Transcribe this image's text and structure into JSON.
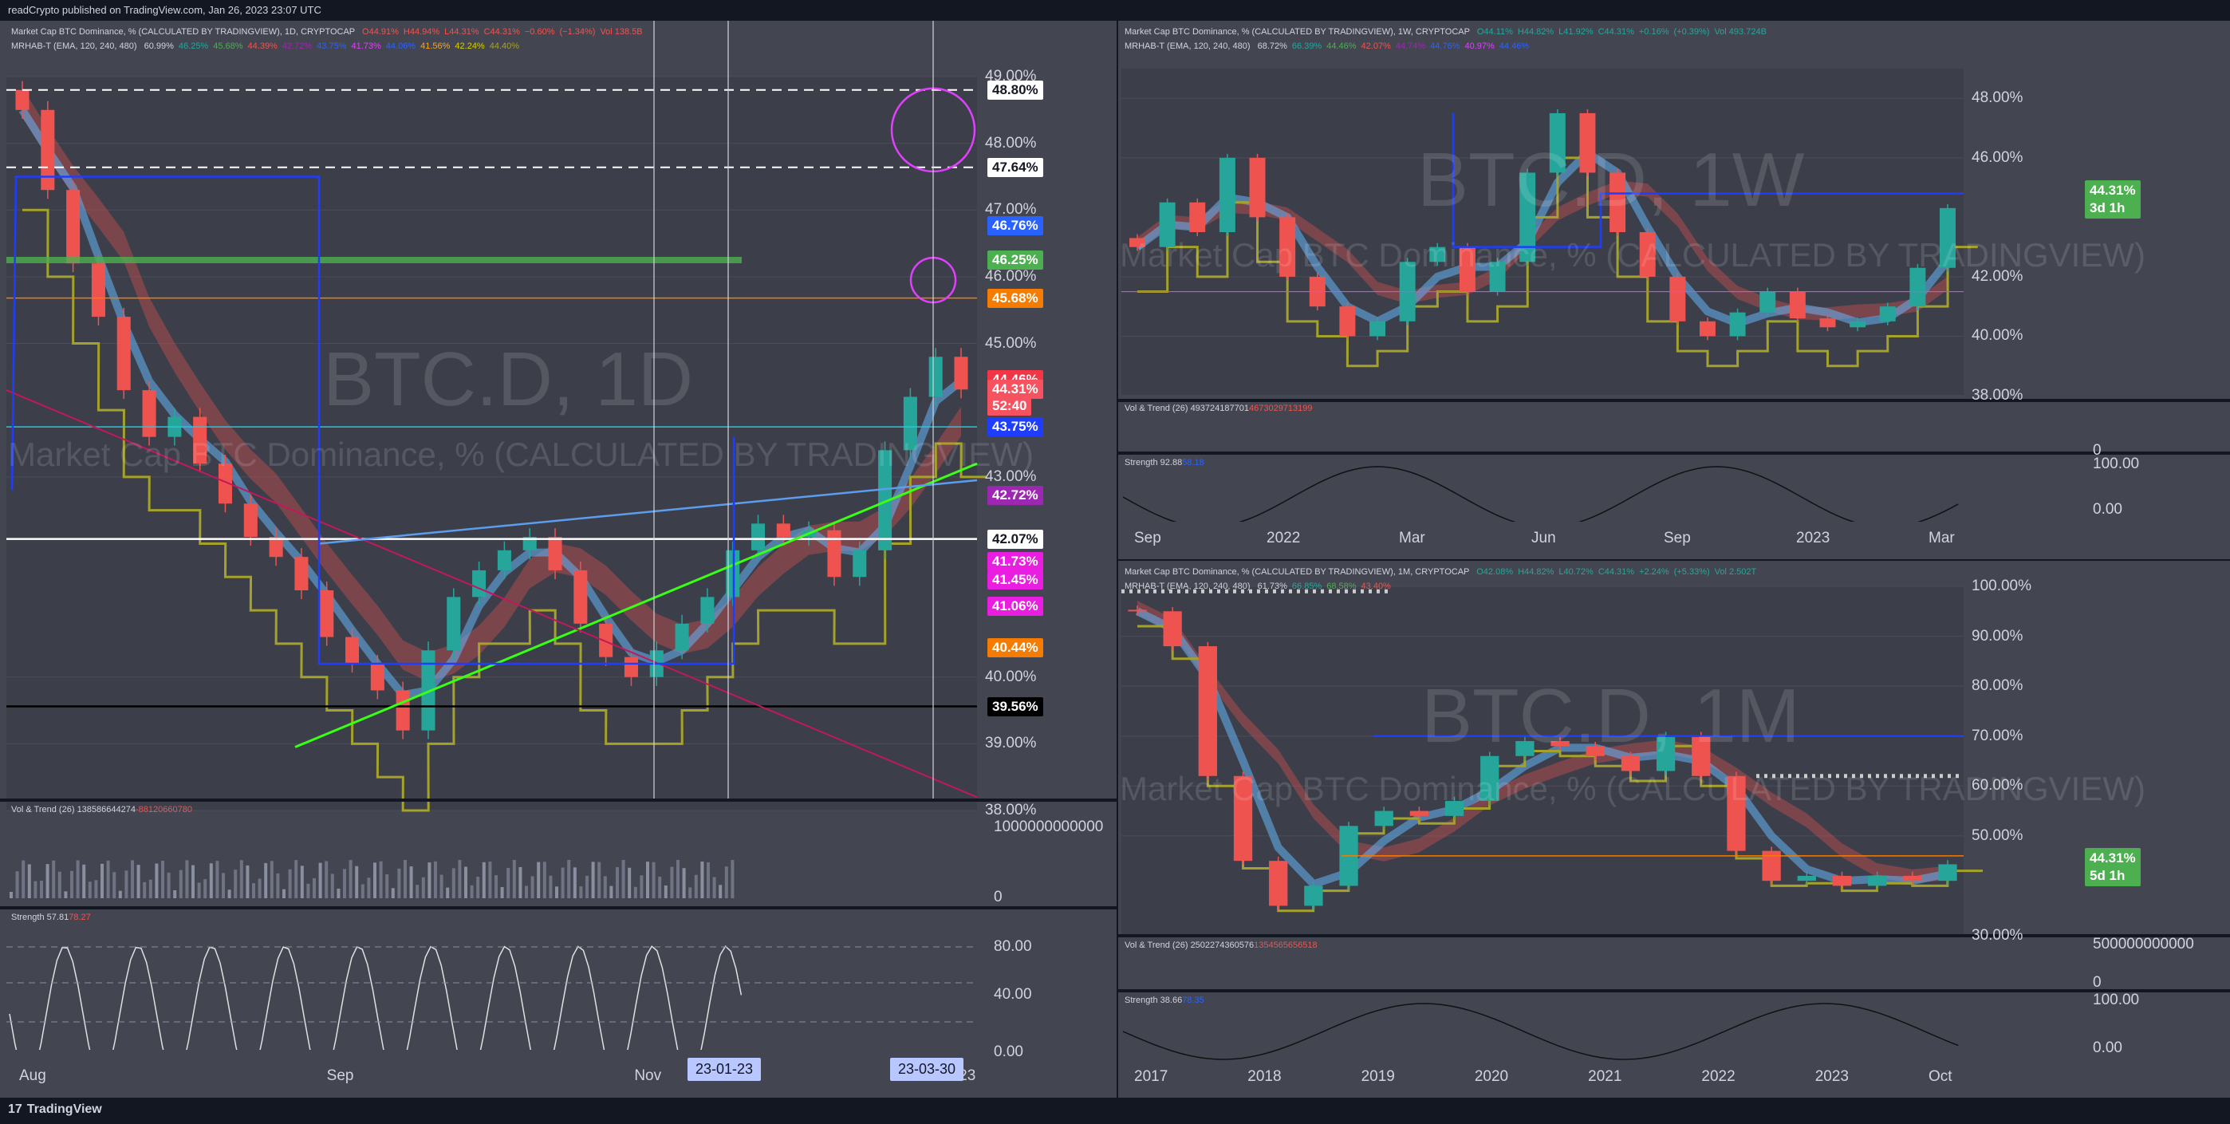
{
  "header": {
    "text": "readCrypto published on TradingView.com, Jan 26, 2023 23:07 UTC"
  },
  "footer": {
    "logo": "TradingView",
    "logo_mark": "17"
  },
  "colors": {
    "bg": "#131722",
    "panel": "#434651",
    "red": "#ef5350",
    "green": "#26a69a",
    "blue": "#1e3dff",
    "olive": "#a4a22a",
    "orange": "#f5a623",
    "magenta": "#e040fb",
    "lime": "#4caf50"
  },
  "panel_daily": {
    "legend_main": "Market Cap BTC Dominance, % (CALCULATED BY TRADINGVIEW), 1D, CRYPTOCAP",
    "legend_main_values": [
      "O44.91%",
      "H44.94%",
      "L44.31%",
      "C44.31%",
      "−0.60%",
      "(−1.34%)",
      "Vol 138.5B"
    ],
    "legend_mrhab": "MRHAB-T (EMA, 120, 240, 480)",
    "legend_mrhab_values": [
      "60.99%",
      "46.25%",
      "45.68%",
      "44.39%",
      "42.72%",
      "43.75%",
      "41.73%",
      "44.06%",
      "41.56%",
      "42.24%",
      "44.40%"
    ],
    "watermark_big": "BTC.D, 1D",
    "watermark_small": "Market Cap BTC Dominance, % (CALCULATED BY TRADINGVIEW)",
    "sub1_legend": "Vol & Trend (26)",
    "sub1_values": [
      "138586644274",
      "-88120660780"
    ],
    "sub2_legend": "Strength",
    "sub2_values": [
      "57.81",
      "78.27"
    ],
    "date_tags": [
      "23-01-23",
      "23-03-30"
    ]
  },
  "panel_weekly": {
    "legend_main": "Market Cap BTC Dominance, % (CALCULATED BY TRADINGVIEW), 1W, CRYPTOCAP",
    "legend_main_values": [
      "O44.11%",
      "H44.82%",
      "L41.92%",
      "C44.31%",
      "+0.16%",
      "(+0.39%)",
      "Vol 493.724B"
    ],
    "legend_mrhab": "MRHAB-T (EMA, 120, 240, 480)",
    "legend_mrhab_values": [
      "68.72%",
      "66.39%",
      "44.46%",
      "42.07%",
      "44.74%",
      "44.76%",
      "40.97%",
      "44.46%"
    ],
    "watermark_big": "BTC.D, 1W",
    "watermark_small": "Market Cap BTC Dominance, % (CALCULATED BY TRADINGVIEW)",
    "price_tag": "44.31%",
    "price_tag_sub": "3d 1h",
    "sub1_legend": "Vol & Trend (26)",
    "sub1_values": [
      "493724187701",
      "4673029713199"
    ],
    "sub2_legend": "Strength",
    "sub2_values": [
      "92.88",
      "58.18"
    ]
  },
  "panel_monthly": {
    "legend_main": "Market Cap BTC Dominance, % (CALCULATED BY TRADINGVIEW), 1M, CRYPTOCAP",
    "legend_main_values": [
      "O42.08%",
      "H44.82%",
      "L40.72%",
      "C44.31%",
      "+2.24%",
      "(+5.33%)",
      "Vol 2.502T"
    ],
    "legend_mrhab": "MRHAB-T (EMA, 120, 240, 480)",
    "legend_mrhab_values": [
      "61.73%",
      "66.85%",
      "68.58%",
      "43.40%"
    ],
    "watermark_big": "BTC.D, 1M",
    "watermark_small": "Market Cap BTC Dominance, % (CALCULATED BY TRADINGVIEW)",
    "price_tag": "44.31%",
    "price_tag_sub": "5d 1h",
    "sub1_legend": "Vol & Trend (26)",
    "sub1_values": [
      "2502274360576",
      "1354565656518"
    ],
    "sub2_legend": "Strength",
    "sub2_values": [
      "38.66",
      "78.35"
    ]
  },
  "chart_data": [
    {
      "type": "line",
      "title": "BTC.D, 1D",
      "x": [
        "Aug",
        "Sep",
        "Nov",
        "2023"
      ],
      "ylim": [
        38.0,
        49.0
      ],
      "y_ticks": [
        "49.00%",
        "48.00%",
        "47.00%",
        "46.00%",
        "45.00%",
        "43.00%",
        "40.00%",
        "39.00%",
        "38.00%"
      ],
      "level_tags": [
        {
          "label": "48.80%",
          "value": 48.8,
          "bg": "#ffffff",
          "fg": "#131722"
        },
        {
          "label": "47.64%",
          "value": 47.64,
          "bg": "#ffffff",
          "fg": "#131722"
        },
        {
          "label": "46.76%",
          "value": 46.76,
          "bg": "#2962ff",
          "fg": "#ffffff"
        },
        {
          "label": "46.25%",
          "value": 46.25,
          "bg": "#4caf50",
          "fg": "#ffffff"
        },
        {
          "label": "45.68%",
          "value": 45.68,
          "bg": "#f57c00",
          "fg": "#ffffff"
        },
        {
          "label": "44.46%",
          "value": 44.46,
          "bg": "#f23645",
          "fg": "#ffffff"
        },
        {
          "label": "44.31%",
          "value": 44.31,
          "bg": "#f7525f",
          "fg": "#ffffff"
        },
        {
          "label": "52:40",
          "value": 44.06,
          "bg": "#f7525f",
          "fg": "#ffffff"
        },
        {
          "label": "43.75%",
          "value": 43.75,
          "bg": "#1e3dff",
          "fg": "#ffffff"
        },
        {
          "label": "42.72%",
          "value": 42.72,
          "bg": "#9c27b0",
          "fg": "#ffffff"
        },
        {
          "label": "42.07%",
          "value": 42.07,
          "bg": "#ffffff",
          "fg": "#131722"
        },
        {
          "label": "41.73%",
          "value": 41.73,
          "bg": "#e91ee0",
          "fg": "#ffffff"
        },
        {
          "label": "41.45%",
          "value": 41.45,
          "bg": "#e91ee0",
          "fg": "#ffffff"
        },
        {
          "label": "41.06%",
          "value": 41.06,
          "bg": "#e91ee0",
          "fg": "#ffffff"
        },
        {
          "label": "40.44%",
          "value": 40.44,
          "bg": "#f57c00",
          "fg": "#ffffff"
        },
        {
          "label": "39.56%",
          "value": 39.56,
          "bg": "#000000",
          "fg": "#ffffff"
        }
      ],
      "series": [
        {
          "name": "",
          "values": [
            48.5,
            47.3,
            46.2,
            45.4,
            44.3,
            43.6,
            43.9,
            43.2,
            42.6,
            42.1,
            41.8,
            41.3,
            40.6,
            40.2,
            39.8,
            39.2,
            40.4,
            41.2,
            41.6,
            41.9,
            42.1,
            41.6,
            40.8,
            40.3,
            40.0,
            40.4,
            40.8,
            41.2,
            41.9,
            42.3,
            42.1,
            42.2,
            41.5,
            41.9,
            43.4,
            44.2,
            44.8,
            44.31
          ]
        }
      ],
      "sub_y_ticks": [
        "1000000000000",
        "0",
        "80.00",
        "40.00",
        "0.00"
      ]
    },
    {
      "type": "line",
      "title": "BTC.D, 1W",
      "x": [
        "Sep",
        "2022",
        "Mar",
        "Jun",
        "Sep",
        "2023",
        "Mar"
      ],
      "ylim": [
        38.0,
        49.0
      ],
      "y_ticks": [
        "48.00%",
        "46.00%",
        "42.00%",
        "40.00%",
        "38.00%"
      ],
      "series": [
        {
          "name": "",
          "values": [
            43.0,
            44.5,
            43.5,
            46.0,
            44.0,
            42.0,
            41.0,
            40.0,
            40.5,
            42.5,
            43.0,
            41.5,
            42.5,
            45.5,
            47.5,
            45.5,
            43.5,
            42.0,
            40.5,
            40.0,
            40.8,
            41.5,
            40.6,
            40.3,
            40.5,
            41.0,
            42.3,
            44.31
          ]
        }
      ],
      "sub_y_ticks": [
        "0",
        "100.00",
        "0.00"
      ]
    },
    {
      "type": "line",
      "title": "BTC.D, 1M",
      "x": [
        "2017",
        "2018",
        "2019",
        "2020",
        "2021",
        "2022",
        "2023",
        "Oct"
      ],
      "ylim": [
        30.0,
        100.0
      ],
      "y_ticks": [
        "100.00%",
        "90.00%",
        "80.00%",
        "70.00%",
        "60.00%",
        "50.00%",
        "30.00%"
      ],
      "series": [
        {
          "name": "",
          "values": [
            95,
            88,
            62,
            45,
            36,
            40,
            52,
            55,
            54,
            57,
            66,
            69,
            68,
            66,
            63,
            70,
            62,
            47,
            41,
            42,
            40,
            42,
            41,
            44.31
          ]
        }
      ],
      "sub_y_ticks": [
        "500000000000",
        "0",
        "100.00",
        "0.00"
      ]
    }
  ]
}
